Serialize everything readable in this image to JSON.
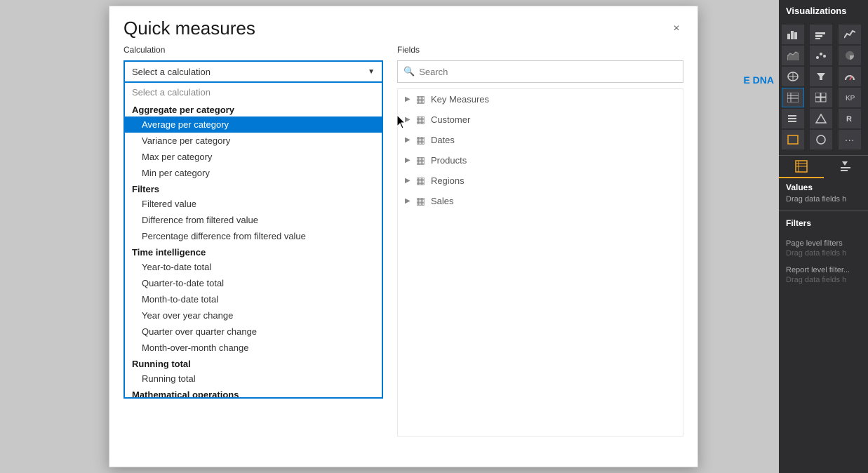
{
  "dialog": {
    "title": "Quick measures",
    "close_label": "×"
  },
  "calculation": {
    "label": "Calculation",
    "placeholder": "Select a calculation",
    "dropdown_arrow": "▼",
    "items": [
      {
        "type": "placeholder",
        "label": "Select a calculation"
      },
      {
        "type": "group",
        "label": "Aggregate per category"
      },
      {
        "type": "item",
        "label": "Average per category",
        "selected": true
      },
      {
        "type": "item",
        "label": "Variance per category"
      },
      {
        "type": "item",
        "label": "Max per category"
      },
      {
        "type": "item",
        "label": "Min per category"
      },
      {
        "type": "group",
        "label": "Filters"
      },
      {
        "type": "item",
        "label": "Filtered value"
      },
      {
        "type": "item",
        "label": "Difference from filtered value"
      },
      {
        "type": "item",
        "label": "Percentage difference from filtered value"
      },
      {
        "type": "group",
        "label": "Time intelligence"
      },
      {
        "type": "item",
        "label": "Year-to-date total"
      },
      {
        "type": "item",
        "label": "Quarter-to-date total"
      },
      {
        "type": "item",
        "label": "Month-to-date total"
      },
      {
        "type": "item",
        "label": "Year over year change"
      },
      {
        "type": "item",
        "label": "Quarter over quarter change"
      },
      {
        "type": "item",
        "label": "Month-over-month change"
      },
      {
        "type": "group",
        "label": "Running total"
      },
      {
        "type": "item",
        "label": "Running total"
      },
      {
        "type": "group",
        "label": "Mathematical operations"
      }
    ]
  },
  "fields": {
    "label": "Fields",
    "search_placeholder": "Search",
    "items": [
      {
        "name": "Key Measures",
        "icon": "table"
      },
      {
        "name": "Customer",
        "icon": "table"
      },
      {
        "name": "Dates",
        "icon": "table"
      },
      {
        "name": "Products",
        "icon": "table"
      },
      {
        "name": "Regions",
        "icon": "table"
      },
      {
        "name": "Sales",
        "icon": "table"
      }
    ]
  },
  "right_panel": {
    "title": "Visualizations",
    "dna_label": "E DNA",
    "values_label": "Values",
    "values_hint": "Drag data fields h",
    "filters_label": "Filters",
    "page_filters": "Page level filters",
    "page_filters_hint": "Drag data fields h",
    "report_filters": "Report level filter...",
    "report_filters_hint": "Drag data fields h"
  }
}
